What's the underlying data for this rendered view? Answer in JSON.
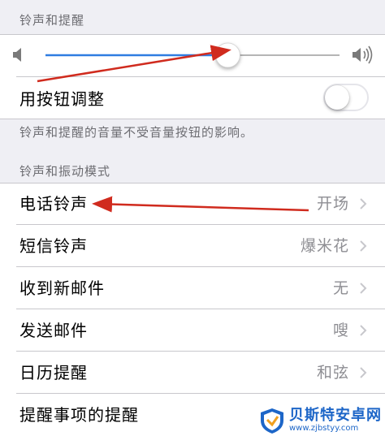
{
  "ringer_section": {
    "header": "铃声和提醒",
    "volume_slider_level": 0.62,
    "change_with_buttons_label": "用按钮调整",
    "change_with_buttons_on": false,
    "footer_note": "铃声和提醒的音量不受音量按钮的影响。"
  },
  "sounds_section": {
    "header": "铃声和振动模式",
    "items": [
      {
        "label": "电话铃声",
        "value": "开场"
      },
      {
        "label": "短信铃声",
        "value": "爆米花"
      },
      {
        "label": "收到新邮件",
        "value": "无"
      },
      {
        "label": "发送邮件",
        "value": "嗖"
      },
      {
        "label": "日历提醒",
        "value": "和弦"
      },
      {
        "label": "提醒事项的提醒",
        "value": ""
      }
    ]
  },
  "watermark": {
    "title": "贝斯特安卓网",
    "url": "www.zjbstyy.com"
  },
  "colors": {
    "slider_fill": "#2f7de1",
    "slider_track": "#b5b5b5",
    "annotation_arrow": "#d02b1e",
    "background": "#efeff4",
    "secondary_text": "#8e8e93"
  }
}
